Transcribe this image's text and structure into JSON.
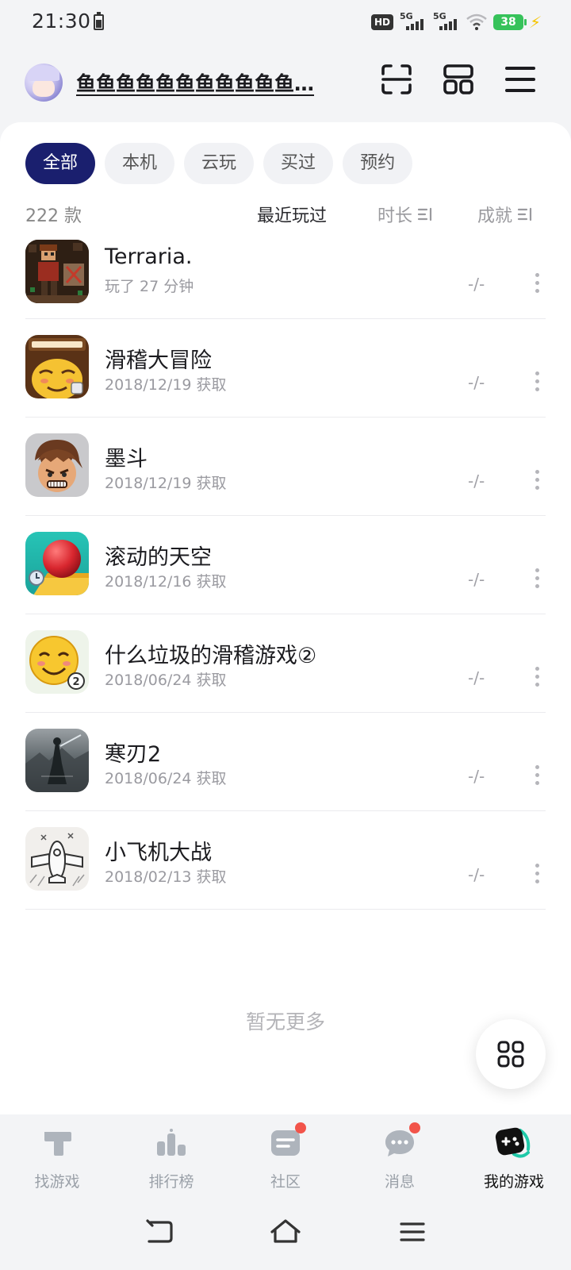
{
  "status_bar": {
    "time": "21:30",
    "hd": "HD",
    "sim1": "5G",
    "sim2": "5G",
    "battery": "38"
  },
  "header": {
    "username": "鱼鱼鱼鱼鱼鱼鱼鱼鱼鱼鱼…"
  },
  "filters": [
    "全部",
    "本机",
    "云玩",
    "买过",
    "预约"
  ],
  "active_filter": "全部",
  "sort_row": {
    "count": "222 款",
    "recent": "最近玩过",
    "duration": "时长",
    "achievement": "成就"
  },
  "games": [
    {
      "title": "Terraria.",
      "subtitle": "玩了 27 分钟",
      "achievement": "-/-",
      "icon": "terraria-icon"
    },
    {
      "title": "滑稽大冒险",
      "subtitle": "2018/12/19 获取",
      "achievement": "-/-",
      "icon": "huaji-adventure-icon"
    },
    {
      "title": "墨斗",
      "subtitle": "2018/12/19 获取",
      "achievement": "-/-",
      "icon": "modou-icon"
    },
    {
      "title": "滚动的天空",
      "subtitle": "2018/12/16 获取",
      "achievement": "-/-",
      "icon": "rolling-sky-icon"
    },
    {
      "title": "什么垃圾的滑稽游戏②",
      "subtitle": "2018/06/24 获取",
      "achievement": "-/-",
      "icon": "huaji-game-icon"
    },
    {
      "title": "寒刃2",
      "subtitle": "2018/06/24 获取",
      "achievement": "-/-",
      "icon": "hanren2-icon"
    },
    {
      "title": "小飞机大战",
      "subtitle": "2018/02/13 获取",
      "achievement": "-/-",
      "icon": "plane-war-icon"
    }
  ],
  "no_more": "暂无更多",
  "bottom_nav": [
    {
      "label": "找游戏",
      "icon": "discover-icon",
      "badge": false
    },
    {
      "label": "排行榜",
      "icon": "ranking-icon",
      "badge": false
    },
    {
      "label": "社区",
      "icon": "community-icon",
      "badge": true
    },
    {
      "label": "消息",
      "icon": "message-icon",
      "badge": true
    },
    {
      "label": "我的游戏",
      "icon": "my-games-icon",
      "badge": false
    }
  ],
  "active_nav": "我的游戏",
  "colors": {
    "accent": "#1a1f6e",
    "badge": "#f2544a",
    "battery": "#36c25a"
  }
}
